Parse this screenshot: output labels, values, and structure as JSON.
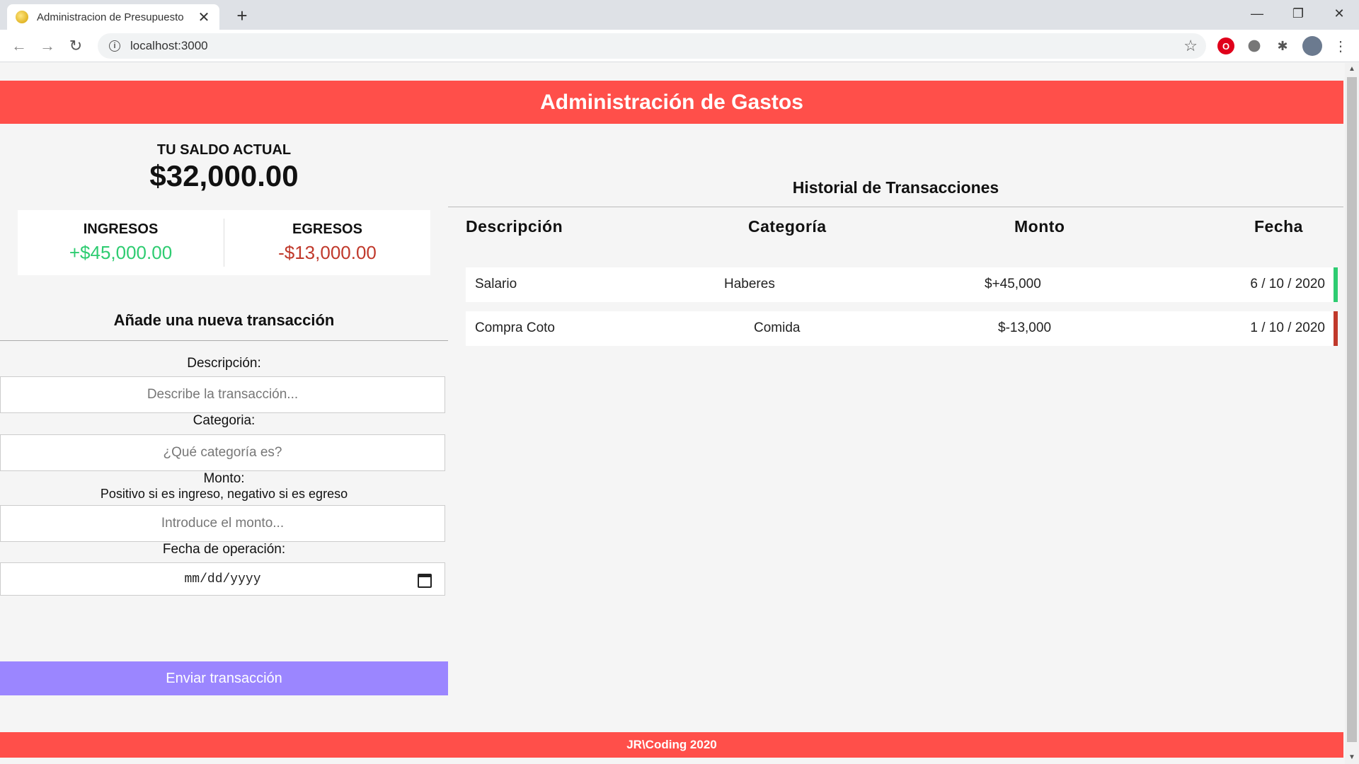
{
  "browser": {
    "tab_title": "Administracion de Presupuesto",
    "url": "localhost:3000"
  },
  "header": {
    "title": "Administración de Gastos"
  },
  "balance": {
    "label": "TU SALDO ACTUAL",
    "value": "$32,000.00"
  },
  "summary": {
    "income_label": "INGRESOS",
    "income_value": "+$45,000.00",
    "expense_label": "EGRESOS",
    "expense_value": "-$13,000.00"
  },
  "form": {
    "title": "Añade una nueva transacción",
    "description_label": "Descripción:",
    "description_placeholder": "Describe la transacción...",
    "category_label": "Categoria:",
    "category_placeholder": "¿Qué categoría es?",
    "amount_label": "Monto:",
    "amount_hint": "Positivo si es ingreso, negativo si es egreso",
    "amount_placeholder": "Introduce el monto...",
    "date_label": "Fecha de operación:",
    "date_placeholder": "mm/dd/yyyy",
    "submit_label": "Enviar transacción"
  },
  "history": {
    "title": "Historial de Transacciones",
    "columns": [
      "Descripción",
      "Categoría",
      "Monto",
      "Fecha"
    ],
    "rows": [
      {
        "description": "Salario",
        "category": "Haberes",
        "amount": "$+45,000",
        "date": "6 / 10 / 2020",
        "type": "income"
      },
      {
        "description": "Compra Coto",
        "category": "Comida",
        "amount": "$-13,000",
        "date": "1 / 10 / 2020",
        "type": "expense"
      }
    ]
  },
  "footer": {
    "text": "JR\\Coding 2020"
  },
  "colors": {
    "accent": "#ff4f4a",
    "income": "#2ecc71",
    "expense": "#c0392b",
    "submit": "#9b86ff"
  }
}
